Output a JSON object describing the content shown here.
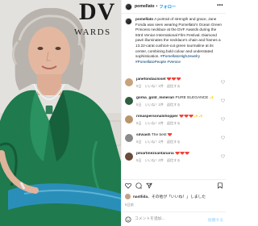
{
  "header": {
    "username": "pomellato",
    "separator": "•",
    "follow_label": "フォロー",
    "more_icon": "more-horizontal-icon"
  },
  "photo": {
    "backdrop_logo": "DV",
    "backdrop_text": "WARDS"
  },
  "caption": {
    "username": "pomellato",
    "text": "A portrait of strength and grace, Jane Fonda was seen wearing Pomellato's Ocean Green Princess necklace at the DVF Awards during the 83rd Venice International Film Festival. Diamond pavé illuminates the necklace's chain and frames a 13.22-carat cushion-cut green tourmaline at its center, combining bold colour and understated sophistication.",
    "hashtags": "#PomellatoHighJewelry #PomellatoPeople #Venice"
  },
  "comments": [
    {
      "username": "janefondacloset",
      "text": "❤️❤️❤️",
      "time": "5日",
      "likes": "いいね！1件",
      "reply": "返信する",
      "avatar_color": "#c9a27a"
    },
    {
      "username": "goma_gold_minerari",
      "text": "PURE ELEGANCE ✨",
      "time": "5日",
      "likes": "いいね！1件",
      "reply": "返信する",
      "avatar_color": "#2e5e3e"
    },
    {
      "username": "rimaspersonalshopper",
      "text": "❤️❤️❤️✨✨",
      "time": "5日",
      "likes": "いいね！2件",
      "reply": "返信する",
      "avatar_color": "#b8956b"
    },
    {
      "username": "silviash",
      "text": "The best ❤️",
      "time": "5日",
      "likes": "いいね！1件",
      "reply": "返信する",
      "avatar_color": "#8a8a8a"
    },
    {
      "username": "pmartinezsantanaria",
      "text": "❤️❤️❤️",
      "time": "5日",
      "likes": "いいね！2件",
      "reply": "返信する",
      "avatar_color": "#6b4a3a"
    }
  ],
  "actions": {
    "like_icon": "heart-outline-icon",
    "comment_icon": "comment-bubble-icon",
    "share_icon": "paper-plane-icon",
    "save_icon": "bookmark-icon"
  },
  "likes": {
    "username": "nastlida",
    "text": "、その他が「いいね！」しました"
  },
  "post_date": "5日前",
  "comment_bar": {
    "placeholder": "コメントを追加...",
    "post_label": "投稿する"
  },
  "colors": {
    "accent_blue": "#0095f6",
    "dress_green": "#1f7a4e",
    "dress_teal": "#2a8fb8"
  }
}
